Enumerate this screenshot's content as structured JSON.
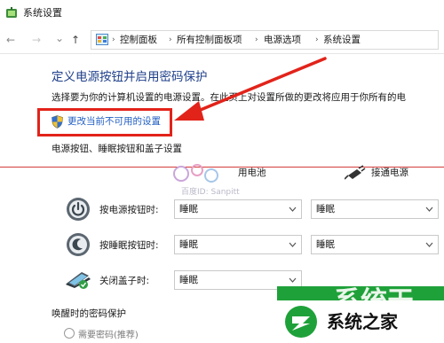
{
  "window": {
    "title": "系统设置"
  },
  "nav": {
    "back_symbol": "←",
    "forward_symbol": "→",
    "dropdown_symbol": "⌄",
    "up_symbol": "↑",
    "breadcrumbs": [
      "控制面板",
      "所有控制面板项",
      "电源选项",
      "系统设置"
    ],
    "separator": "›"
  },
  "main": {
    "heading": "定义电源按钮并启用密码保护",
    "description": "选择要为你的计算机设置的电源设置。在此页上对设置所做的更改将应用于你所有的电",
    "change_link": "更改当前不可用的设置",
    "section_power_buttons": "电源按钮、睡眠按钮和盖子设置",
    "columns": {
      "battery": "用电池",
      "plugged_in": "接通电源"
    },
    "rows": [
      {
        "label": "按电源按钮时:",
        "icon": "power-icon",
        "battery": "睡眠",
        "plugged": "睡眠"
      },
      {
        "label": "按睡眠按钮时:",
        "icon": "sleep-icon",
        "battery": "睡眠",
        "plugged": "睡眠"
      },
      {
        "label": "关闭盖子时:",
        "icon": "laptop-lid-icon",
        "battery": "睡眠",
        "plugged": ""
      }
    ],
    "section_wake_password": "唤醒时的密码保护",
    "radio_require_password": "需要密码(推荐)"
  },
  "watermark": {
    "text_id": "百度ID: Sanpitt",
    "site_text": "系统之家",
    "green_text": "系统天"
  },
  "colors": {
    "heading": "#1f3f8a",
    "link": "#1f5dc2",
    "highlight_box": "#e2231a",
    "annotation_arrow": "#e2231a",
    "watermark_green": "#1fa139"
  }
}
